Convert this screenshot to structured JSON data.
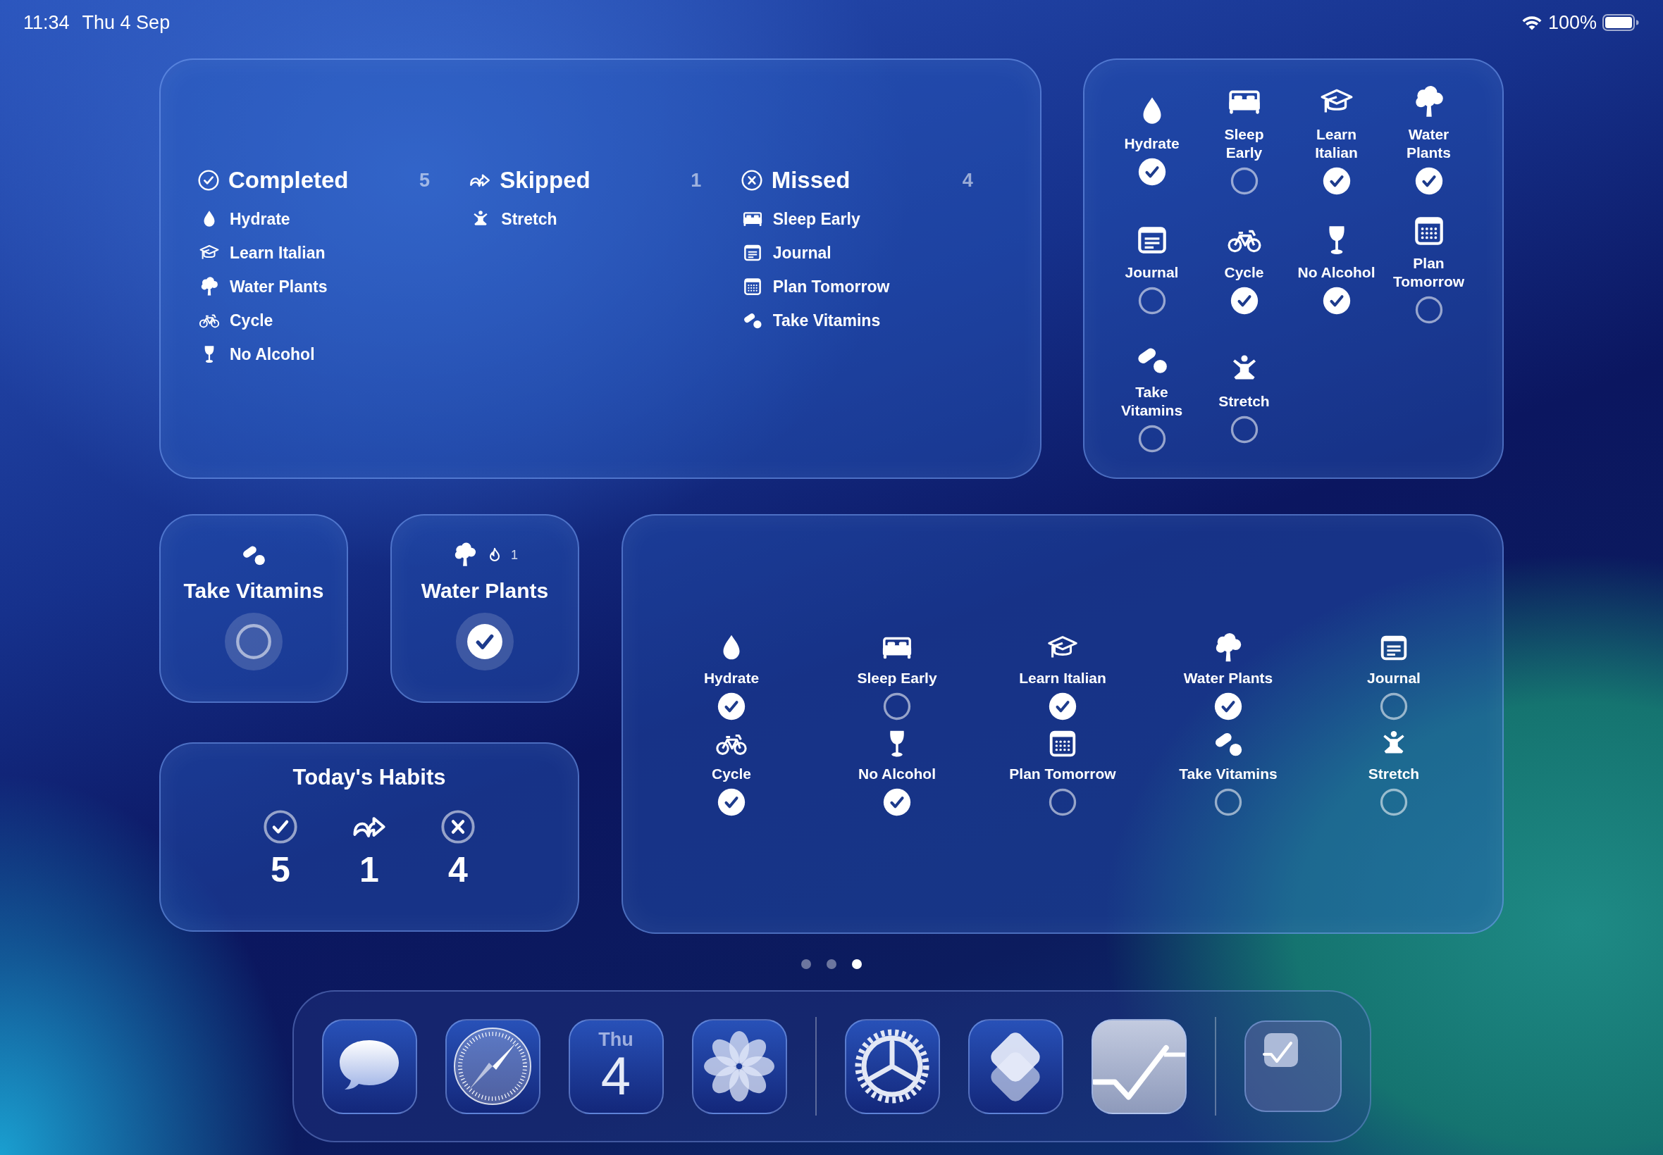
{
  "status_bar": {
    "time": "11:34",
    "date": "Thu 4 Sep",
    "battery": "100%"
  },
  "summary_widget": {
    "groups": [
      {
        "kind": "completed",
        "title": "Completed",
        "count": "5",
        "habits": [
          {
            "kind": "drop",
            "label": "Hydrate"
          },
          {
            "kind": "cap",
            "label": "Learn Italian"
          },
          {
            "kind": "tree",
            "label": "Water Plants"
          },
          {
            "kind": "bike",
            "label": "Cycle"
          },
          {
            "kind": "glass",
            "label": "No Alcohol"
          }
        ]
      },
      {
        "kind": "skipped",
        "title": "Skipped",
        "count": "1",
        "habits": [
          {
            "kind": "yoga",
            "label": "Stretch"
          }
        ]
      },
      {
        "kind": "missed",
        "title": "Missed",
        "count": "4",
        "habits": [
          {
            "kind": "bed",
            "label": "Sleep Early"
          },
          {
            "kind": "note",
            "label": "Journal"
          },
          {
            "kind": "calendar",
            "label": "Plan Tomorrow"
          },
          {
            "kind": "pills",
            "label": "Take Vitamins"
          }
        ]
      }
    ]
  },
  "checklist_widget": {
    "rows": [
      {
        "habits": [
          {
            "kind": "drop",
            "label": "Hydrate",
            "checked": true
          },
          {
            "kind": "bed",
            "label": "Sleep Early",
            "wrap": true,
            "checked": false
          },
          {
            "kind": "cap",
            "label": "Learn Italian",
            "wrap": true,
            "checked": true
          },
          {
            "kind": "tree",
            "label": "Water Plants",
            "wrap": true,
            "checked": true
          }
        ]
      },
      {
        "habits": [
          {
            "kind": "note",
            "label": "Journal",
            "checked": false
          },
          {
            "kind": "bike",
            "label": "Cycle",
            "checked": true
          },
          {
            "kind": "glass",
            "label": "No Alcohol",
            "wrap": false,
            "checked": true
          },
          {
            "kind": "calendar",
            "label": "Plan Tomorrow",
            "wrap": true,
            "checked": false
          }
        ]
      },
      {
        "habits": [
          {
            "kind": "pills",
            "label": "Take Vitamins",
            "wrap": true,
            "checked": false
          },
          {
            "kind": "yoga",
            "label": "Stretch",
            "checked": false
          }
        ]
      }
    ]
  },
  "single_habit_widgets": [
    {
      "kind": "pills",
      "title": "Take Vitamins",
      "checked": false
    },
    {
      "kind": "tree",
      "title": "Water Plants",
      "checked": true,
      "streak": "1"
    }
  ],
  "todays_habits_widget": {
    "title": "Today's Habits",
    "stats": [
      {
        "kind": "completed",
        "count": "5"
      },
      {
        "kind": "skipped",
        "count": "1"
      },
      {
        "kind": "missed",
        "count": "4"
      }
    ]
  },
  "grid_widget": {
    "habits": [
      {
        "kind": "drop",
        "label": "Hydrate",
        "checked": true
      },
      {
        "kind": "bed",
        "label": "Sleep Early",
        "checked": false
      },
      {
        "kind": "cap",
        "label": "Learn Italian",
        "checked": true
      },
      {
        "kind": "tree",
        "label": "Water Plants",
        "checked": true
      },
      {
        "kind": "note",
        "label": "Journal",
        "checked": false
      },
      {
        "kind": "bike",
        "label": "Cycle",
        "checked": true
      },
      {
        "kind": "glass",
        "label": "No Alcohol",
        "checked": true
      },
      {
        "kind": "calendar",
        "label": "Plan Tomorrow",
        "checked": false
      },
      {
        "kind": "pills",
        "label": "Take Vitamins",
        "checked": false
      },
      {
        "kind": "yoga",
        "label": "Stretch",
        "checked": false
      }
    ]
  },
  "page_dots": [
    {
      "selected": false
    },
    {
      "selected": false
    },
    {
      "selected": true
    }
  ],
  "dock": {
    "sections": [
      {
        "apps": [
          {
            "kind": "bubble"
          },
          {
            "kind": "compass"
          },
          {
            "kind": "calendar",
            "weekday": "Thu",
            "day": "4"
          },
          {
            "kind": "flower"
          }
        ]
      },
      {
        "apps": [
          {
            "kind": "gear"
          },
          {
            "kind": "layers"
          },
          {
            "kind": "check"
          }
        ]
      },
      {
        "apps": [
          {
            "kind": "recent"
          }
        ]
      }
    ]
  }
}
